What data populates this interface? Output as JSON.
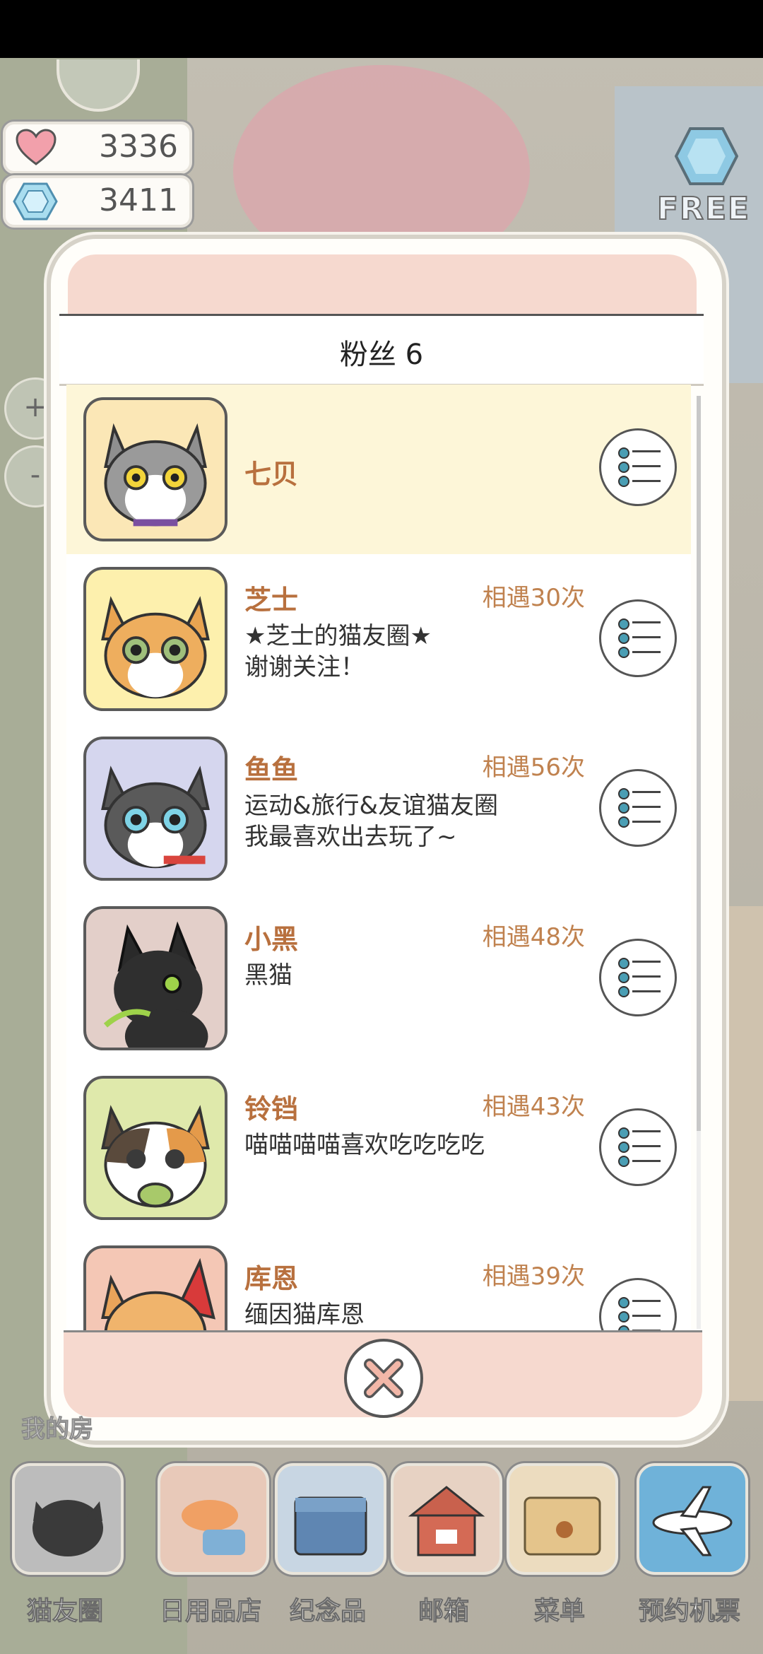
{
  "status": {
    "hearts": "3336",
    "gems": "3411"
  },
  "free_badge": "FREE",
  "zoom": {
    "plus": "+",
    "minus": "-"
  },
  "followers_dialog": {
    "title": "粉丝 6",
    "items": [
      {
        "name": "七贝",
        "meet": "",
        "desc1": "",
        "desc2": "",
        "selected": true
      },
      {
        "name": "芝士",
        "meet": "相遇30次",
        "desc1": "★芝士的猫友圈★",
        "desc2": "谢谢关注！"
      },
      {
        "name": "鱼鱼",
        "meet": "相遇56次",
        "desc1": "运动&旅行&友谊猫友圈",
        "desc2": "我最喜欢出去玩了~"
      },
      {
        "name": "小黑",
        "meet": "相遇48次",
        "desc1": "黑猫",
        "desc2": ""
      },
      {
        "name": "铃铛",
        "meet": "相遇43次",
        "desc1": "喵喵喵喵喜欢吃吃吃吃",
        "desc2": ""
      },
      {
        "name": "库恩",
        "meet": "相遇39次",
        "desc1": "缅因猫库恩",
        "desc2": ""
      }
    ]
  },
  "my_room_label": "我的房",
  "bottom_nav": [
    {
      "label": "猫友圈",
      "icon": "cat-camera-icon",
      "color": "#5b5b5b"
    },
    {
      "label": "日用品店",
      "icon": "fish-shop-icon",
      "color": "#e8c9b9"
    },
    {
      "label": "纪念品",
      "icon": "box-icon",
      "color": "#6d93b8"
    },
    {
      "label": "邮箱",
      "icon": "mailbox-icon",
      "color": "#c9614d"
    },
    {
      "label": "菜单",
      "icon": "folder-icon",
      "color": "#e4c48b"
    },
    {
      "label": "预约机票",
      "icon": "airplane-icon",
      "color": "#6fb2d9"
    }
  ]
}
